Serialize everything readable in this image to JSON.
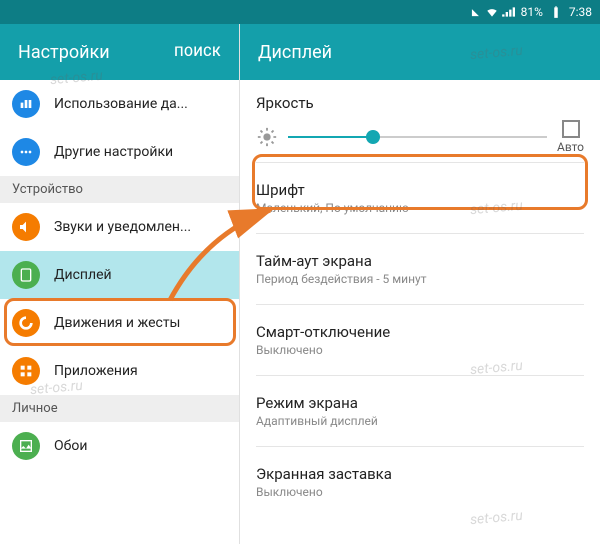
{
  "status": {
    "battery": "81%",
    "time": "7:38"
  },
  "left": {
    "title": "Настройки",
    "search": "ПОИСК",
    "items": [
      {
        "label": "Использование да...",
        "colors": "#1e88e5"
      },
      {
        "label": "Другие настройки",
        "colors": "#1e88e5"
      }
    ],
    "section1": "Устройство",
    "device_items": [
      {
        "label": "Звуки и уведомлен...",
        "color": "#f57c00"
      },
      {
        "label": "Дисплей",
        "color": "#4caf50"
      },
      {
        "label": "Движения и жесты",
        "color": "#f57c00"
      },
      {
        "label": "Приложения",
        "color": "#f57c00"
      }
    ],
    "section2": "Личное",
    "personal_items": [
      {
        "label": "Обои",
        "color": "#4caf50"
      }
    ]
  },
  "right": {
    "title": "Дисплей",
    "brightness_label": "Яркость",
    "auto_label": "Авто",
    "rows": [
      {
        "title": "Шрифт",
        "sub": "Маленький, По умолчанию"
      },
      {
        "title": "Тайм-аут экрана",
        "sub": "Период бездействия - 5 минут"
      },
      {
        "title": "Смарт-отключение",
        "sub": "Выключено"
      },
      {
        "title": "Режим экрана",
        "sub": "Адаптивный дисплей"
      },
      {
        "title": "Экранная заставка",
        "sub": "Выключено"
      }
    ]
  },
  "watermark": "set-os.ru"
}
